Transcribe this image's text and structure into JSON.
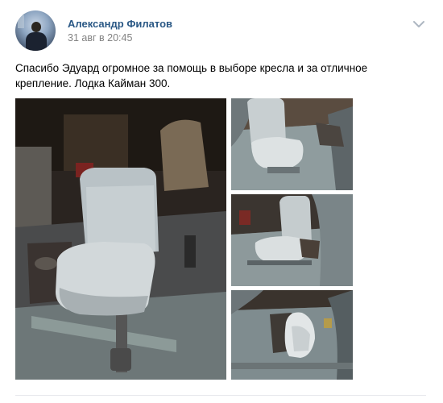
{
  "post": {
    "author": "Александр Филатов",
    "date": "31 авг в 20:45",
    "text": "Спасибо Эдуард огромное за помощь в выборе кресла и за отличное крепление. Лодка Кайман 300.",
    "icons": {
      "menu": "chevron-down-icon"
    },
    "photos": [
      {
        "subject": "boat seat in garage"
      },
      {
        "subject": "seat mounted in boat, top view"
      },
      {
        "subject": "seat mounted in boat, side view"
      },
      {
        "subject": "seat folded down in boat"
      }
    ]
  },
  "colors": {
    "author_link": "#2a5885",
    "date": "#828282",
    "background": "#ffffff"
  }
}
